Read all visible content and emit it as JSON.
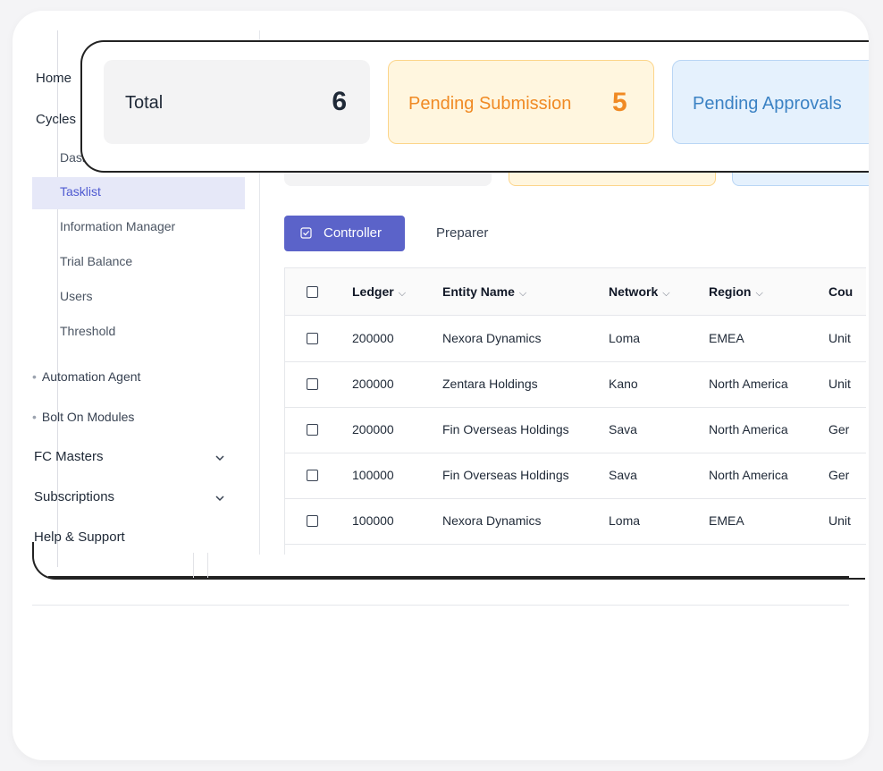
{
  "sidebar": {
    "home": "Home",
    "cycles": "Cycles",
    "dashboard_partial": "Dasl",
    "tasklist": "Tasklist",
    "information_manager": "Information Manager",
    "trial_balance": "Trial Balance",
    "users": "Users",
    "threshold": "Threshold",
    "automation_agent": "Automation Agent",
    "bolt_on_modules": "Bolt On Modules",
    "fc_masters": "FC Masters",
    "subscriptions": "Subscriptions",
    "help_support": "Help & Support"
  },
  "stats": {
    "total_label": "Total",
    "total_value": "6",
    "pending_submission_label": "Pending Submission",
    "pending_submission_value": "5",
    "pending_approvals_label": "Pending Approvals"
  },
  "tabs": {
    "controller": "Controller",
    "preparer": "Preparer"
  },
  "table": {
    "headers": {
      "ledger": "Ledger",
      "entity_name": "Entity Name",
      "network": "Network",
      "region": "Region",
      "country_partial": "Cou"
    },
    "rows": [
      {
        "ledger": "200000",
        "entity": "Nexora Dynamics",
        "network": "Loma",
        "region": "EMEA",
        "country": "Unit"
      },
      {
        "ledger": "200000",
        "entity": "Zentara Holdings",
        "network": "Kano",
        "region": "North America",
        "country": "Unit"
      },
      {
        "ledger": "200000",
        "entity": "Fin Overseas Holdings",
        "network": "Sava",
        "region": "North America",
        "country": "Ger"
      },
      {
        "ledger": "100000",
        "entity": "Fin Overseas Holdings",
        "network": "Sava",
        "region": "North America",
        "country": "Ger"
      },
      {
        "ledger": "100000",
        "entity": "Nexora Dynamics",
        "network": "Loma",
        "region": "EMEA",
        "country": "Unit"
      }
    ]
  },
  "colors": {
    "accent": "#5b63c9",
    "pending_submission": "#f08a24",
    "pending_approvals": "#3b82c4",
    "active_nav_bg": "#e6e8f8"
  }
}
